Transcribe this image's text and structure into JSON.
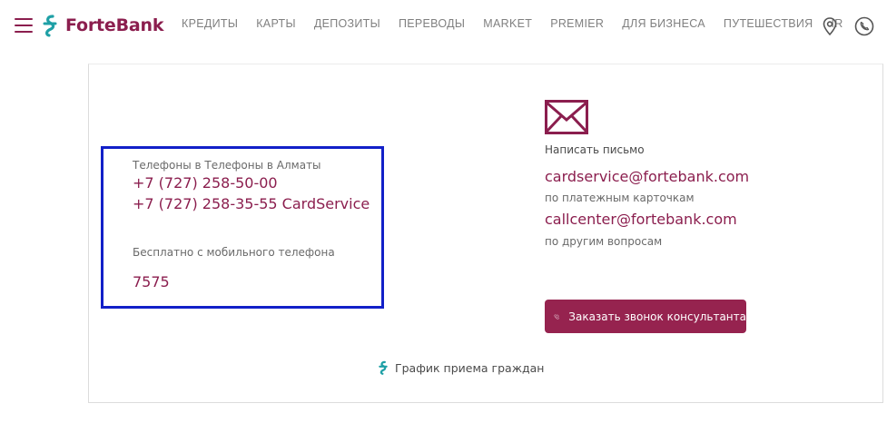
{
  "header": {
    "logo_text": "ForteBank",
    "nav": [
      {
        "label": "КРЕДИТЫ"
      },
      {
        "label": "КАРТЫ"
      },
      {
        "label": "ДЕПОЗИТЫ"
      },
      {
        "label": "ПЕРЕВОДЫ"
      },
      {
        "label": "MARKET"
      },
      {
        "label": "PREMIER"
      },
      {
        "label": "ДЛЯ БИЗНЕСА"
      },
      {
        "label": "ПУТЕШЕСТВИЯ"
      },
      {
        "label": "IR"
      }
    ]
  },
  "phones": {
    "title": "Телефоны в Телефоны в Алматы",
    "phone1": "+7 (727) 258-50-00",
    "phone2": "+7 (727) 258-35-55 CardService",
    "free_label": "Бесплатно с мобильного телефона",
    "short_number": "7575"
  },
  "email": {
    "title": "Написать письмо",
    "addr1": "cardservice@fortebank.com",
    "addr1_desc": "по платежным карточкам",
    "addr2": "callcenter@fortebank.com",
    "addr2_desc": "по другим вопросам"
  },
  "call_button": {
    "label": "Заказать звонок консультанта"
  },
  "schedule_link": {
    "label": "График приема граждан"
  },
  "colors": {
    "brand": "#8b1e4e",
    "accent": "#1fa0a6",
    "highlight": "#1220c8"
  }
}
